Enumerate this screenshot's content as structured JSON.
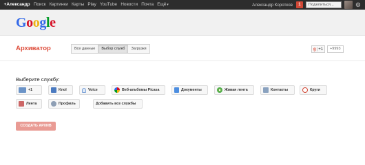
{
  "topbar": {
    "nav": [
      "+Александр",
      "Поиск",
      "Картинки",
      "Карты",
      "Play",
      "YouTube",
      "Новости",
      "Почта",
      "Ещё"
    ],
    "user_name": "Александр Коротков",
    "notification_count": "1",
    "share_label": "Поделиться..."
  },
  "header": {
    "logo_text": "Google"
  },
  "page": {
    "title": "Архиватор",
    "tabs": [
      "Все данные",
      "Выбор служб",
      "Загрузки"
    ],
    "gplus_label": "+1",
    "gplus_count": "+9993"
  },
  "services": {
    "prompt": "Выберите службу:",
    "items": [
      {
        "label": "+1",
        "icon": "plus-one-icon"
      },
      {
        "label": "Knol",
        "icon": "knol-icon"
      },
      {
        "label": "Voice",
        "icon": "voice-icon"
      },
      {
        "label": "Веб-альбомы Picasa",
        "icon": "picasa-icon"
      },
      {
        "label": "Документы",
        "icon": "docs-icon"
      },
      {
        "label": "Живая лента",
        "icon": "buzz-icon"
      },
      {
        "label": "Контакты",
        "icon": "contacts-icon"
      },
      {
        "label": "Круги",
        "icon": "circles-icon"
      },
      {
        "label": "Лента",
        "icon": "stream-icon"
      },
      {
        "label": "Профиль",
        "icon": "profile-icon"
      },
      {
        "label": "Добавить все службы",
        "icon": ""
      }
    ],
    "create_label": "СОЗДАТЬ АРХИВ"
  },
  "colors": {
    "accent": "#dd4b39",
    "topbar": "#2d2d2d",
    "create_button": "#e99b94"
  }
}
